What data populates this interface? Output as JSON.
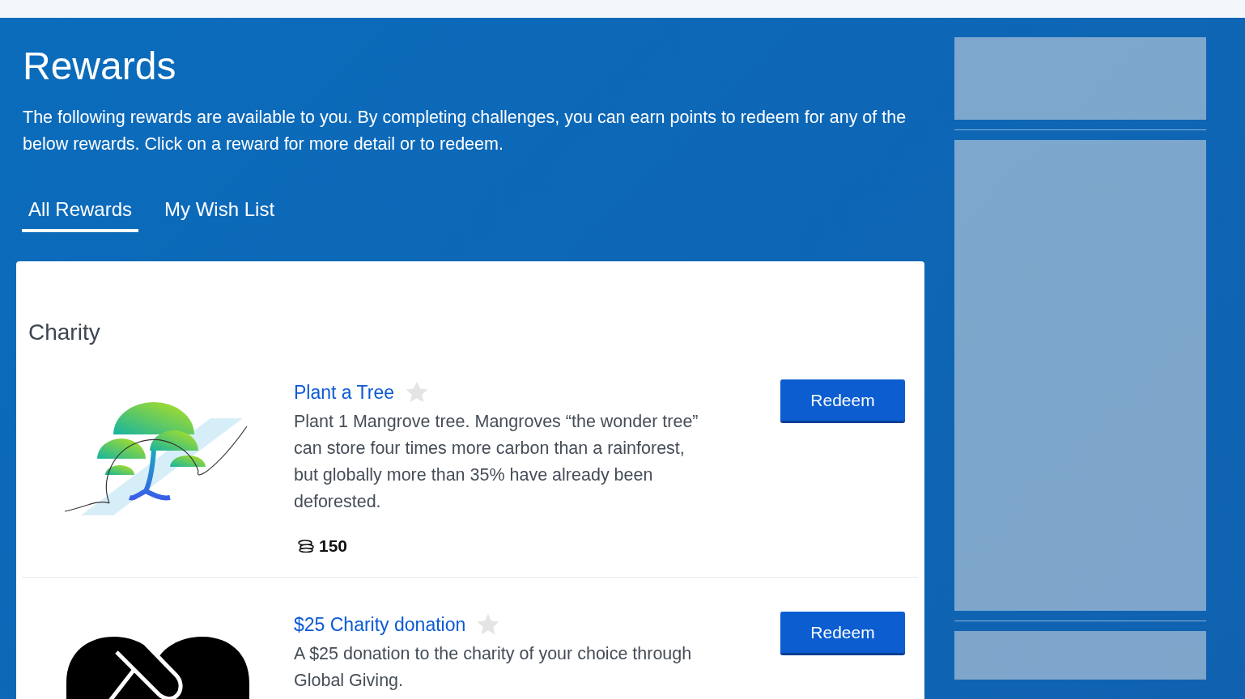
{
  "page": {
    "title": "Rewards",
    "intro": "The following rewards are available to you. By completing challenges, you can earn points to redeem for any of the below rewards. Click on a reward for more detail or to redeem."
  },
  "tabs": [
    {
      "label": "All Rewards",
      "selected": true
    },
    {
      "label": "My Wish List",
      "selected": false
    }
  ],
  "category": "Charity",
  "rewards": [
    {
      "kind": "tree",
      "title": "Plant a Tree",
      "wishlisted": false,
      "description": "Plant 1 Mangrove tree. Mangroves “the wonder tree” can store four times more carbon than a rainforest, but globally more than 35% have already been deforested.",
      "points": "150",
      "button": "Redeem"
    },
    {
      "kind": "heart",
      "title": "$25 Charity donation",
      "wishlisted": false,
      "description": "A $25 donation to the charity of your choice through Global Giving.",
      "button": "Redeem"
    }
  ]
}
